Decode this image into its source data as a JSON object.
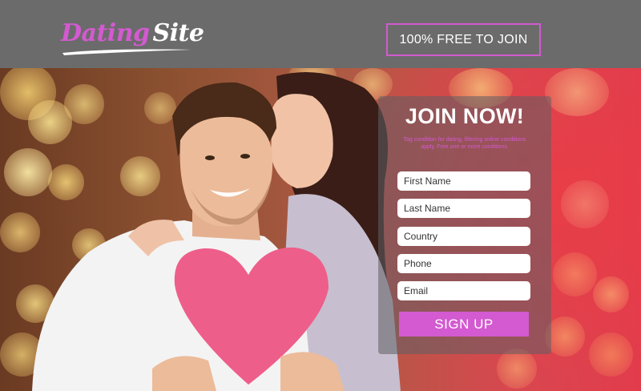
{
  "header": {
    "logo_word1": "Dating",
    "logo_word2": "Site",
    "free_label": "100% FREE TO JOIN"
  },
  "form": {
    "title": "JOIN NOW!",
    "subtitle": "Tag condition for dating, filtering online conditions apply. Free one or more conditions.",
    "fields": [
      {
        "placeholder": "First Name"
      },
      {
        "placeholder": "Last Name"
      },
      {
        "placeholder": "Country"
      },
      {
        "placeholder": "Phone"
      },
      {
        "placeholder": "Email"
      }
    ],
    "submit_label": "SIGN UP"
  },
  "colors": {
    "header_bg": "#6b6b6b",
    "accent": "#d35ad0",
    "button_text": "#ffffff"
  },
  "icons": [
    "heart-icon"
  ]
}
